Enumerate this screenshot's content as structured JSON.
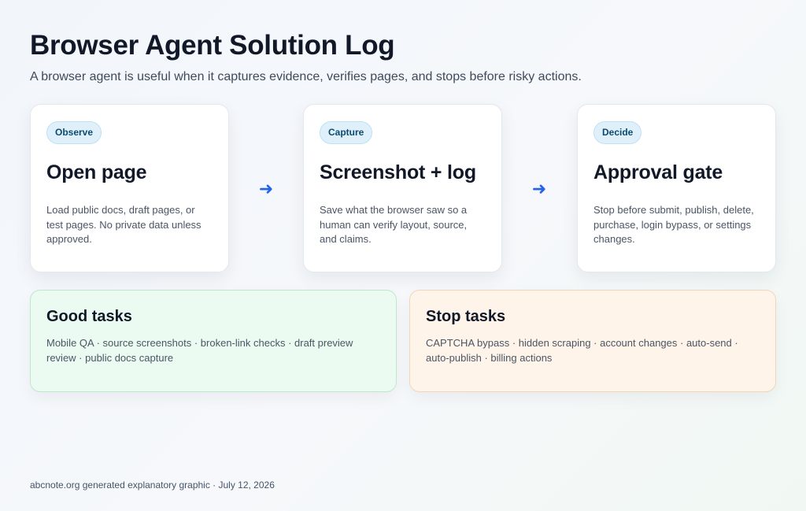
{
  "header": {
    "title": "Browser Agent Solution Log",
    "subtitle": "A browser agent is useful when it captures evidence, verifies pages, and stops before risky actions."
  },
  "steps": [
    {
      "badge": "Observe",
      "title": "Open page",
      "description": "Load public docs, draft pages, or test pages. No private data unless approved."
    },
    {
      "badge": "Capture",
      "title": "Screenshot + log",
      "description": "Save what the browser saw so a human can verify layout, source, and claims."
    },
    {
      "badge": "Decide",
      "title": "Approval gate",
      "description": "Stop before submit, publish, delete, purchase, login bypass, or settings changes."
    }
  ],
  "arrows": {
    "glyph": "➜",
    "color": "#2563eb"
  },
  "good_tasks": {
    "title": "Good tasks",
    "text": "Mobile QA · source screenshots · broken-link checks · draft preview review · public docs capture",
    "background": "#ecfbf1"
  },
  "stop_tasks": {
    "title": "Stop tasks",
    "text": "CAPTCHA bypass · hidden scraping · account changes · auto-send · auto-publish · billing actions",
    "background": "#fff4e9"
  },
  "footer": {
    "text": "abcnote.org generated explanatory graphic · July 12, 2026"
  }
}
